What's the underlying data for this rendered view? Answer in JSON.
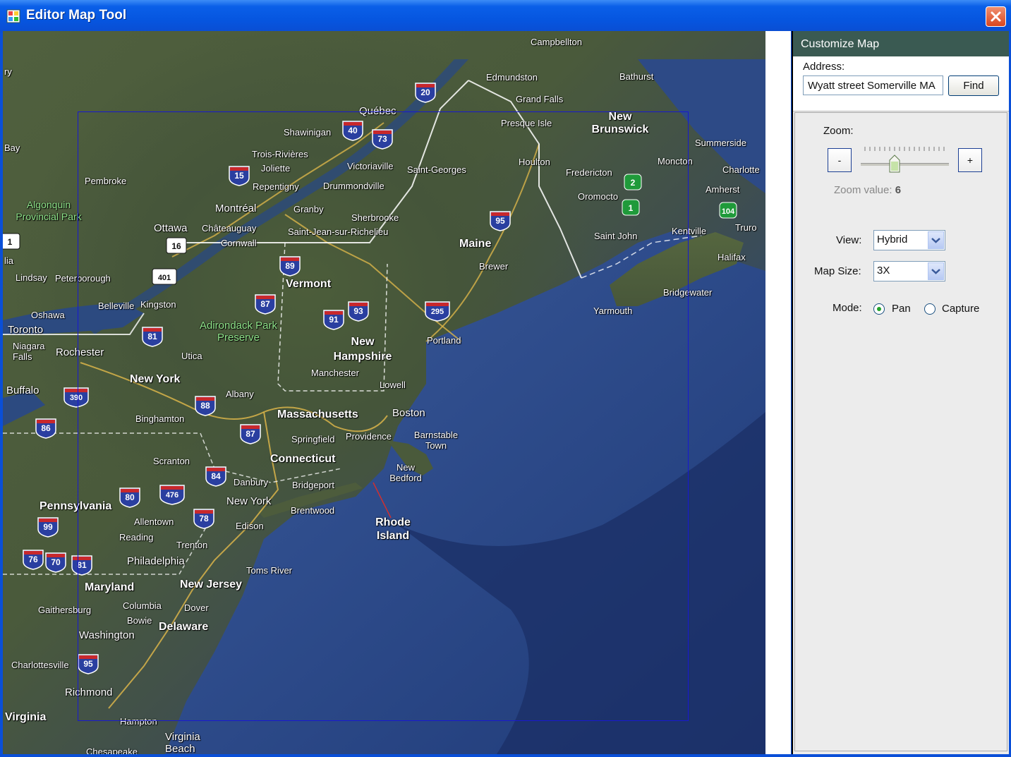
{
  "window": {
    "title": "Editor Map Tool",
    "app_icon": "app-window-icon",
    "close_icon": "close-icon"
  },
  "map": {
    "view": "Hybrid",
    "labels": {
      "quebec": "Québec",
      "campbellton": "Campbellton",
      "edmundston": "Edmundston",
      "bathurst": "Bathurst",
      "grand_falls": "Grand Falls",
      "presque_isle": "Presque Isle",
      "new_brunswick": "New Brunswick",
      "summerside": "Summerside",
      "charlotte": "Charlotte",
      "houlton": "Houlton",
      "fredericton": "Fredericton",
      "moncton": "Moncton",
      "amherst": "Amherst",
      "oromocto": "Oromocto",
      "saint_john": "Saint John",
      "kentville": "Kentville",
      "truro": "Truro",
      "halifax": "Halifax",
      "bridgewater": "Bridgewater",
      "yarmouth": "Yarmouth",
      "shawinigan": "Shawinigan",
      "trois_rivieres": "Trois-Rivières",
      "joliette": "Joliette",
      "victoriaville": "Victoriaville",
      "saint_georges": "Saint-Georges",
      "repentigny": "Repentigny",
      "drummondville": "Drummondville",
      "pembroke": "Pembroke",
      "algonquin": "Algonquin Provincial Park",
      "montreal": "Montréal",
      "granby": "Granby",
      "sherbrooke": "Sherbrooke",
      "ottawa": "Ottawa",
      "chateauguay": "Châteauguay",
      "saint_jean": "Saint-Jean-sur-Richelieu",
      "cornwall": "Cornwall",
      "maine": "Maine",
      "brewer": "Brewer",
      "lindsay": "Lindsay",
      "peterborough": "Peterborough",
      "vermont": "Vermont",
      "belleville": "Belleville",
      "kingston": "Kingston",
      "oshawa": "Oshawa",
      "toronto": "Toronto",
      "adirondack": "Adirondack Park Preserve",
      "portland": "Portland",
      "niagara": "Niagara Falls",
      "rochester": "Rochester",
      "utica": "Utica",
      "new_hampshire": "New Hampshire",
      "manchester": "Manchester",
      "buffalo": "Buffalo",
      "new_york_state": "New York",
      "lowell": "Lowell",
      "albany": "Albany",
      "massachusetts": "Massachusetts",
      "boston": "Boston",
      "binghamton": "Binghamton",
      "barnstable": "Barnstable Town",
      "springfield": "Springfield",
      "providence": "Providence",
      "scranton": "Scranton",
      "connecticut": "Connecticut",
      "new_bedford": "New Bedford",
      "danbury": "Danbury",
      "bridgeport": "Bridgeport",
      "new_york_city": "New York",
      "brentwood": "Brentwood",
      "pennsylvania": "Pennsylvania",
      "allentown": "Allentown",
      "edison": "Edison",
      "rhode_island": "Rhode Island",
      "reading": "Reading",
      "trenton": "Trenton",
      "philadelphia": "Philadelphia",
      "toms_river": "Toms River",
      "maryland": "Maryland",
      "new_jersey": "New Jersey",
      "gaithersburg": "Gaithersburg",
      "columbia": "Columbia",
      "dover": "Dover",
      "bowie": "Bowie",
      "delaware": "Delaware",
      "washington": "Washington",
      "charlottesville": "Charlottesville",
      "richmond": "Richmond",
      "virginia": "Virginia",
      "hampton": "Hampton",
      "virginia_beach": "Virginia Beach",
      "chesapeake": "Chesapeake",
      "bay": "Bay",
      "ry": "ry",
      "lia": "lia"
    },
    "shields": [
      "20",
      "40",
      "73",
      "15",
      "16",
      "401",
      "95",
      "89",
      "87",
      "93",
      "91",
      "295",
      "81",
      "390",
      "88",
      "86",
      "87",
      "84",
      "80",
      "476",
      "78",
      "99",
      "76",
      "70",
      "81",
      "95",
      "1",
      "2",
      "104",
      "1"
    ]
  },
  "panel": {
    "header": "Customize Map",
    "address_label": "Address:",
    "address_value": "Wyatt street Somerville MA",
    "find_label": "Find",
    "zoom_label": "Zoom:",
    "zoom_minus": "-",
    "zoom_plus": "+",
    "zoom_value_label": "Zoom value:",
    "zoom_value": "6",
    "view_label": "View:",
    "view_value": "Hybrid",
    "map_size_label": "Map Size:",
    "map_size_value": "3X",
    "mode_label": "Mode:",
    "mode_pan": "Pan",
    "mode_capture": "Capture",
    "mode_selected": "Pan"
  }
}
